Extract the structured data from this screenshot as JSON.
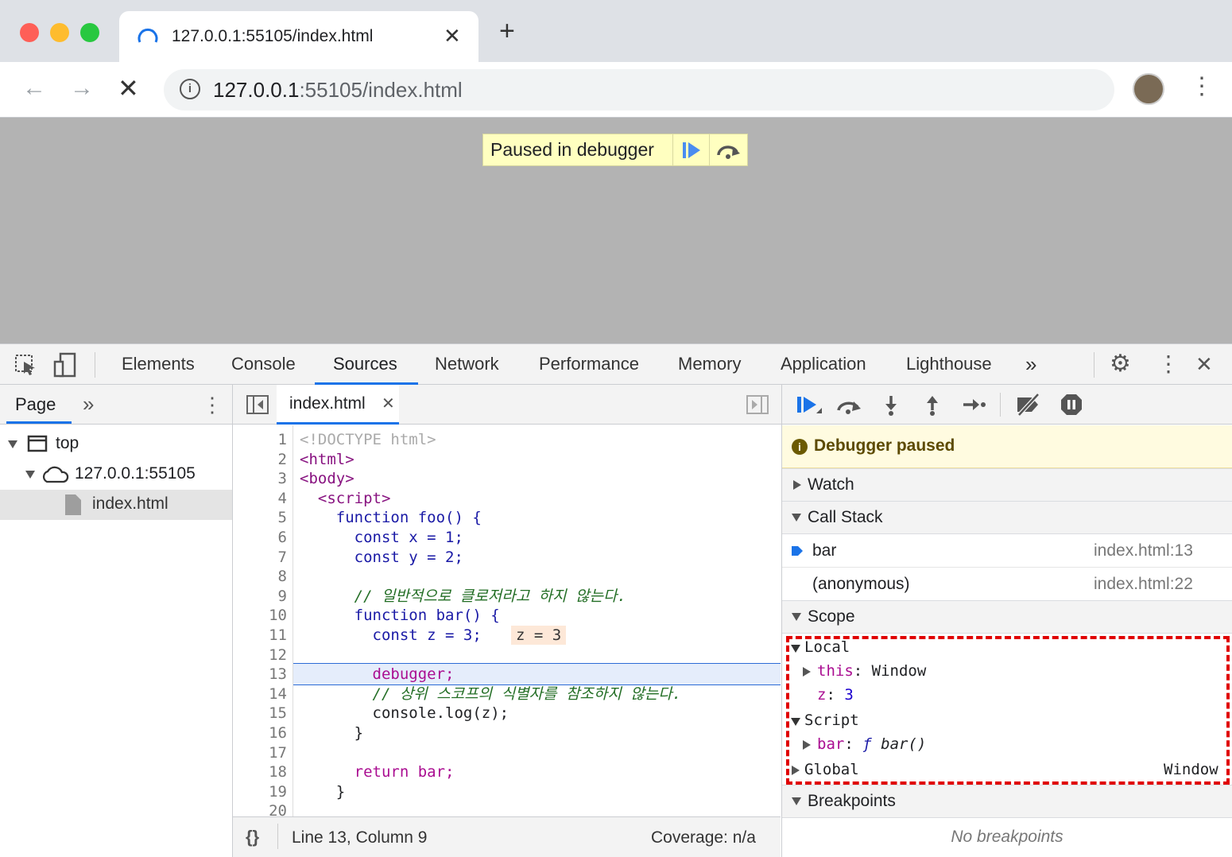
{
  "browser": {
    "tab_title": "127.0.0.1:55105/index.html",
    "url_host": "127.0.0.1",
    "url_rest": ":55105/index.html"
  },
  "page": {
    "paused_text": "Paused in debugger"
  },
  "devtools": {
    "tabs": [
      "Elements",
      "Console",
      "Sources",
      "Network",
      "Performance",
      "Memory",
      "Application",
      "Lighthouse"
    ],
    "active_tab": "Sources",
    "navigator": {
      "tab_label": "Page",
      "tree": [
        "top",
        "127.0.0.1:55105",
        "index.html"
      ]
    },
    "editor": {
      "file_tab": "index.html",
      "lines": [
        {
          "n": "1",
          "t": "<!DOCTYPE html>"
        },
        {
          "n": "2",
          "t": "<html>"
        },
        {
          "n": "3",
          "t": "<body>"
        },
        {
          "n": "4",
          "t": "  <script>"
        },
        {
          "n": "5",
          "t": "    function foo() {"
        },
        {
          "n": "6",
          "t": "      const x = 1;"
        },
        {
          "n": "7",
          "t": "      const y = 2;"
        },
        {
          "n": "8",
          "t": ""
        },
        {
          "n": "9",
          "t": "      // 일반적으로 클로저라고 하지 않는다."
        },
        {
          "n": "10",
          "t": "      function bar() {"
        },
        {
          "n": "11",
          "t": "        const z = 3;"
        },
        {
          "n": "12",
          "t": ""
        },
        {
          "n": "13",
          "t": "        debugger;"
        },
        {
          "n": "14",
          "t": "        // 상위 스코프의 식별자를 참조하지 않는다."
        },
        {
          "n": "15",
          "t": "        console.log(z);"
        },
        {
          "n": "16",
          "t": "      }"
        },
        {
          "n": "17",
          "t": ""
        },
        {
          "n": "18",
          "t": "      return bar;"
        },
        {
          "n": "19",
          "t": "    }"
        },
        {
          "n": "20",
          "t": ""
        }
      ],
      "inline_value": "z = 3",
      "status": "Line 13, Column 9",
      "coverage": "Coverage: n/a",
      "format_btn": "{}"
    },
    "debugger": {
      "paused_title": "Debugger paused",
      "watch": "Watch",
      "call_stack": "Call Stack",
      "frames": [
        {
          "name": "bar",
          "loc": "index.html:13"
        },
        {
          "name": "(anonymous)",
          "loc": "index.html:22"
        }
      ],
      "scope": "Scope",
      "local": "Local",
      "this_key": "this",
      "this_val": "Window",
      "z_key": "z",
      "z_val": "3",
      "script": "Script",
      "bar_key": "bar",
      "bar_f": "ƒ",
      "bar_val": "bar()",
      "global": "Global",
      "global_val": "Window",
      "breakpoints": "Breakpoints",
      "no_breakpoints": "No breakpoints"
    }
  },
  "colors": {
    "accent": "#1a73e8",
    "highlight_red": "#e00000",
    "paused_bg": "#fffbe0"
  }
}
